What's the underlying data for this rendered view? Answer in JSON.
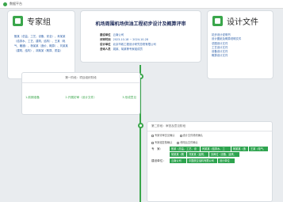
{
  "app": {
    "title": "数据平台"
  },
  "expert": {
    "title": "专家组",
    "members_text": "甄某（总监、工艺、设备、安全）、肖某某（给排水、工艺、建筑、结构）、王某（电气、暖通）、杨某某（造价、概算）、刘某某（建筑、结构）、胡某某（概算、质量）"
  },
  "project": {
    "title": "机场周围机场供油工程初步设计及概算评审",
    "lines": [
      {
        "label": "建设单位",
        "value": "云南公司"
      },
      {
        "label": "评审时间",
        "value": "2023-10-18 ~ 2024-10-28"
      },
      {
        "label": "设计单位",
        "value": "北京市政工程设计研究总院有限公司"
      },
      {
        "label": "咨询人员",
        "value": "姚某、胡某等专家组成员"
      }
    ]
  },
  "design": {
    "title": "设计文件",
    "items": [
      "初步设计说明书",
      "设计图纸及概算说明文件",
      "总图设计文件",
      "工艺设计文件",
      "设备设计文件",
      "概算设计文件"
    ]
  },
  "stage1": {
    "title": "第一阶段：项目组织阶段",
    "tasks": [
      "1.前期准备",
      "2.开展初审（设计文件）",
      "3.形成意见"
    ]
  },
  "stage2": {
    "title": "第二阶段：审查及意见阶段",
    "checks": [
      "专家评审意见确认",
      "设计文件修改确认",
      "专家组复核确认",
      "修改后文件确认"
    ],
    "groups": [
      {
        "label": "专　家：",
        "tags": [
          "甄某（总监、工艺、设备）",
          "肖某某（给排水、工艺、建筑）",
          "杨某某（造价）",
          "王某（电气、暖通）",
          "胡某某（概算）",
          "刘某某（建筑、结构）",
          "另两位（设备、建筑、结构）"
        ]
      },
      {
        "label": "建设单位：",
        "tags": [
          "云南公司",
          "中国航空油料有限公司",
          "设计单位"
        ]
      }
    ]
  }
}
